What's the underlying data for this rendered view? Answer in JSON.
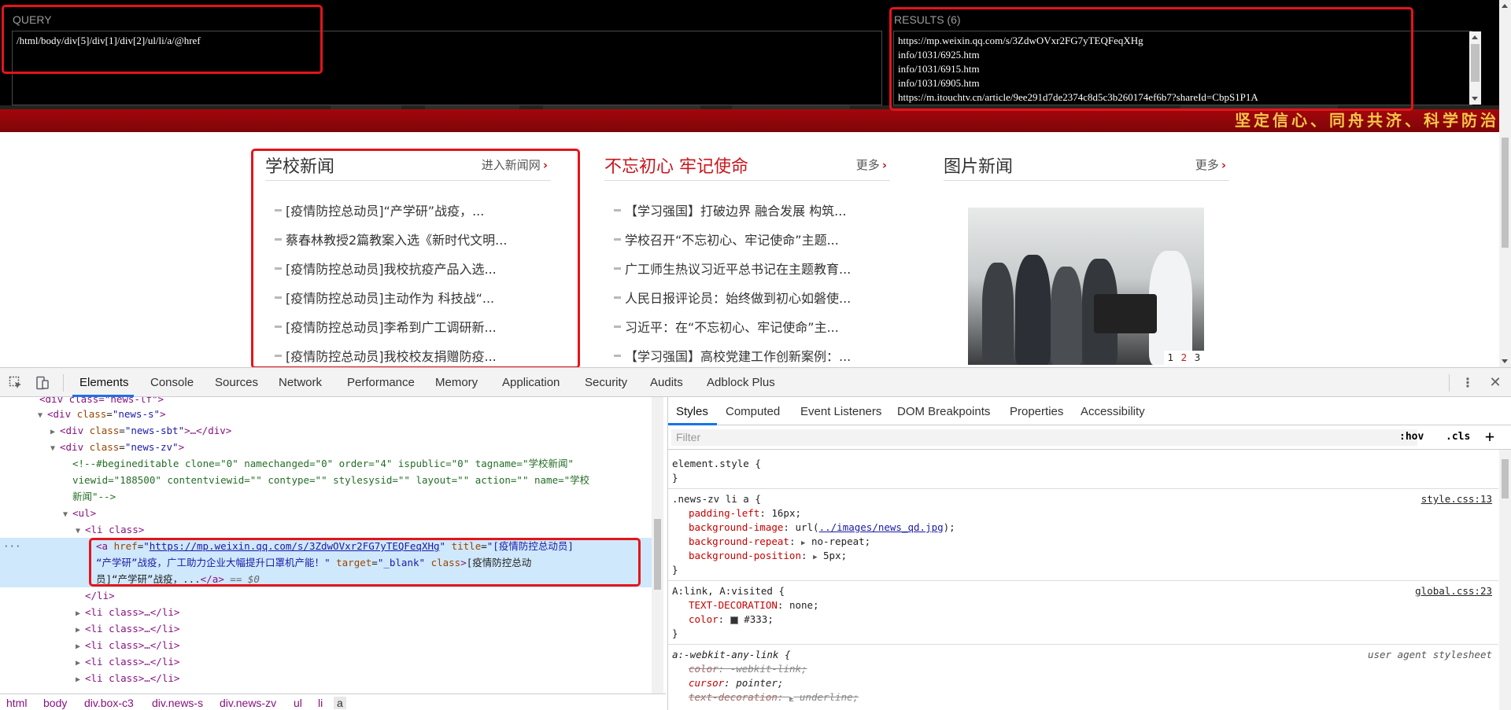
{
  "xpath_helper": {
    "query_label": "QUERY",
    "query_value": "/html/body/div[5]/div[1]/div[2]/ul/li/a/@href",
    "results_label": "RESULTS (6)",
    "results": [
      "https://mp.weixin.qq.com/s/3ZdwOVxr2FG7yTEQFeqXHg",
      "info/1031/6925.htm",
      "info/1031/6915.htm",
      "info/1031/6905.htm",
      "https://m.itouchtv.cn/article/9ee291d7de2374c8d5c3b260174ef6b7?shareId=CbpS1P1A"
    ]
  },
  "banner": {
    "slogan": "坚定信心、同舟共济、科学防治"
  },
  "columns": [
    {
      "title": "学校新闻",
      "more": "进入新闻网",
      "items": [
        "[疫情防控总动员]“产学研”战疫，...",
        "蔡春林教授2篇教案入选《新时代文明...",
        "[疫情防控总动员]我校抗疫产品入选...",
        "[疫情防控总动员]主动作为 科技战“...",
        "[疫情防控总动员]李希到广工调研新...",
        "[疫情防控总动员]我校校友捐赠防疫..."
      ]
    },
    {
      "title": "不忘初心 牢记使命",
      "more": "更多",
      "items": [
        "【学习强国】打破边界 融合发展 构筑...",
        "学校召开“不忘初心、牢记使命”主题...",
        "广工师生热议习近平总书记在主题教育...",
        "人民日报评论员：始终做到初心如磐使...",
        "习近平：在“不忘初心、牢记使命”主...",
        "【学习强国】高校党建工作创新案例：..."
      ]
    },
    {
      "title": "图片新闻",
      "more": "更多",
      "pager": [
        "1",
        "2",
        "3"
      ]
    }
  ],
  "devtools": {
    "tabs": [
      "Elements",
      "Console",
      "Sources",
      "Network",
      "Performance",
      "Memory",
      "Application",
      "Security",
      "Audits",
      "Adblock Plus"
    ],
    "active_tab": "Elements",
    "styles_tabs": [
      "Styles",
      "Computed",
      "Event Listeners",
      "DOM Breakpoints",
      "Properties",
      "Accessibility"
    ],
    "filter_placeholder": "Filter",
    "hov_label": ":hov",
    "cls_label": ".cls",
    "dom": {
      "l0": "div class=\"news-lf\"",
      "l1_tag": "div",
      "l1_val": "news-s",
      "l2_tag": "div",
      "l2_val": "news-sbt",
      "l3_tag": "div",
      "l3_val": "news-zv",
      "comment_1": "<!--#begineditable clone=\"0\" namechanged=\"0\" order=\"4\" ispublic=\"0\" tagname=\"学校新闻\"",
      "comment_2": "viewid=\"188500\" contentviewid=\"\" contype=\"\" stylesysid=\"\" layout=\"\" action=\"\" name=\"学校",
      "comment_3": "新闻\"-->",
      "ul": "ul",
      "li_open": "li class",
      "a_href": "https://mp.weixin.qq.com/s/3ZdwOVxr2FG7yTEQFeqXHg",
      "a_title_1": "[疫情防控总动员]",
      "a_title_2": "“产学研”战疫，广工助力企业大幅提升口罩机产能！",
      "a_target": "_blank",
      "a_text_1": "[疫情防控总动",
      "a_text_2": "员]“产学研”战疫，...",
      "eq0": "== $0",
      "li_close": "/li",
      "li_collapsed": "<li class>…</li>"
    },
    "styles": {
      "r0_sel": "element.style {",
      "r1_sel": ".news-zv li a {",
      "r1_src": "style.css:13",
      "r1_p1": "padding-left",
      "r1_v1": "16px;",
      "r1_p2": "background-image",
      "r1_v2a": "url(",
      "r1_v2b": "../images/news_qd.jpg",
      "r1_v2c": ");",
      "r1_p3": "background-repeat",
      "r1_v3": "no-repeat;",
      "r1_p4": "background-position",
      "r1_v4": "5px;",
      "r2_sel": "A:link, A:visited {",
      "r2_src": "global.css:23",
      "r2_p1": "TEXT-DECORATION",
      "r2_v1": "none;",
      "r2_p2": "color",
      "r2_v2": "#333;",
      "r3_sel": "a:-webkit-any-link {",
      "r3_src": "user agent stylesheet",
      "r3_p1": "color",
      "r3_v1": "-webkit-link;",
      "r3_p2": "cursor",
      "r3_v2": "pointer;",
      "r3_p3": "text-decoration",
      "r3_v3": "underline;",
      "brace": "}"
    },
    "breadcrumbs": [
      "html",
      "body",
      "div.box-c3",
      "div.news-s",
      "div.news-zv",
      "ul",
      "li",
      "a"
    ]
  },
  "colors": {
    "accent": "#1a73e8",
    "annotation": "#e5141b",
    "brand_red": "#c8161d"
  }
}
